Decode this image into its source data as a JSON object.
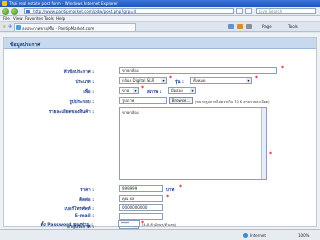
{
  "browser": {
    "window_title": "Thai real estate post form - Windows Internet Explorer",
    "url": "http://www.pantipmarket.com/pdw/post.php?grp=4",
    "search_placeholder": "Live Search",
    "menu": [
      "File",
      "View",
      "Favorites",
      "Tools",
      "Help"
    ],
    "tab_title": "ลงประกาศขาย/ซื้อ - PantipMarket.com",
    "toolbar": {
      "page_label": "Page",
      "tools_label": "Tools"
    }
  },
  "form": {
    "header": "ข้อมูลประกาศ",
    "fields": {
      "title_label": "หัวข้อประกาศ :",
      "title_value": "ขายกล้อง",
      "type_label": "ประเภท :",
      "type_value": "กล้อง Digital SLR",
      "model_label": "รุ่น :",
      "model_value": "ทั้งหมด",
      "condition_label": "เพื่อ :",
      "condition_value": "ขาย",
      "state_label": "สภาพ :",
      "state_value": "มือสอง",
      "photo_label": "รูปประกอบ :",
      "photo_value": "รูปภาพ",
      "browse_label": "Browse...",
      "photo_note": "(ขนาดรูปภาพไม่ควรเกิน 70 K ตามรายละเอียด)",
      "detail_label": "รายละเอียดของสินค้า :",
      "detail_value": "ขายกล้อง",
      "price_label": "ราคา :",
      "price_value": "999999",
      "price_unit": "บาท",
      "contact_label": "ติดต่อ :",
      "contact_value": "คุณ xx",
      "phone_label": "เบอร์โทรศัพท์ :",
      "phone_value": "0000000000",
      "email_label": "E-mail :",
      "email_value": "",
      "duration_label": "อายุประกาศ :",
      "duration_value": "7 วัน",
      "password_label": "ตั้ง Password ของท่าน :",
      "password_value": "****",
      "password_note": "(4-8 ตัวอักษร/ตัวเลข)"
    }
  },
  "status": {
    "zone": "Internet",
    "zoom": "100%"
  }
}
